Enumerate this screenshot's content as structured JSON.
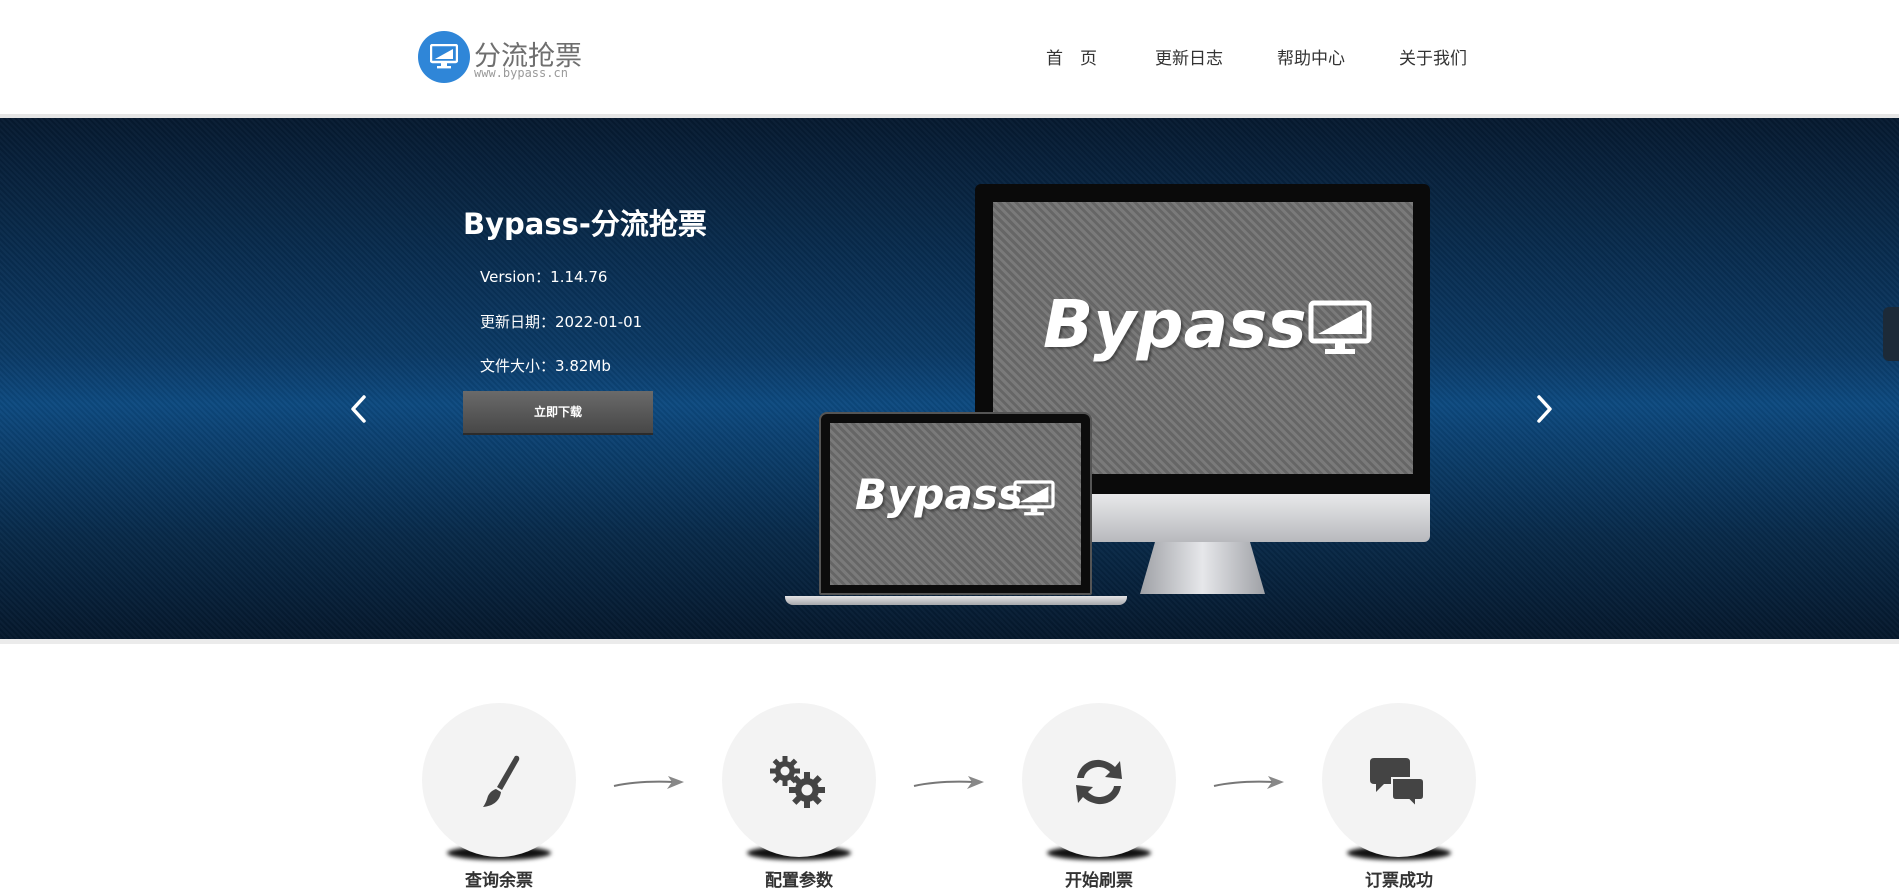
{
  "brand": {
    "name": "分流抢票",
    "url": "www.bypass.cn",
    "color": "#2f86d8"
  },
  "nav": {
    "home": "首　页",
    "changelog": "更新日志",
    "help": "帮助中心",
    "about": "关于我们"
  },
  "banner": {
    "title": "Bypass-分流抢票",
    "version_label": "Version：",
    "version_value": "1.14.76",
    "date_label": "更新日期：",
    "date_value": "2022-01-01",
    "size_label": "文件大小：",
    "size_value": "3.82Mb",
    "download_label": "立即下载",
    "screen_text": "Bypass",
    "prev_icon": "chevron-left-icon",
    "next_icon": "chevron-right-icon"
  },
  "steps": [
    {
      "label": "查询余票",
      "icon": "brush-icon"
    },
    {
      "label": "配置参数",
      "icon": "gears-icon"
    },
    {
      "label": "开始刷票",
      "icon": "refresh-icon"
    },
    {
      "label": "订票成功",
      "icon": "chat-bubbles-icon"
    }
  ]
}
